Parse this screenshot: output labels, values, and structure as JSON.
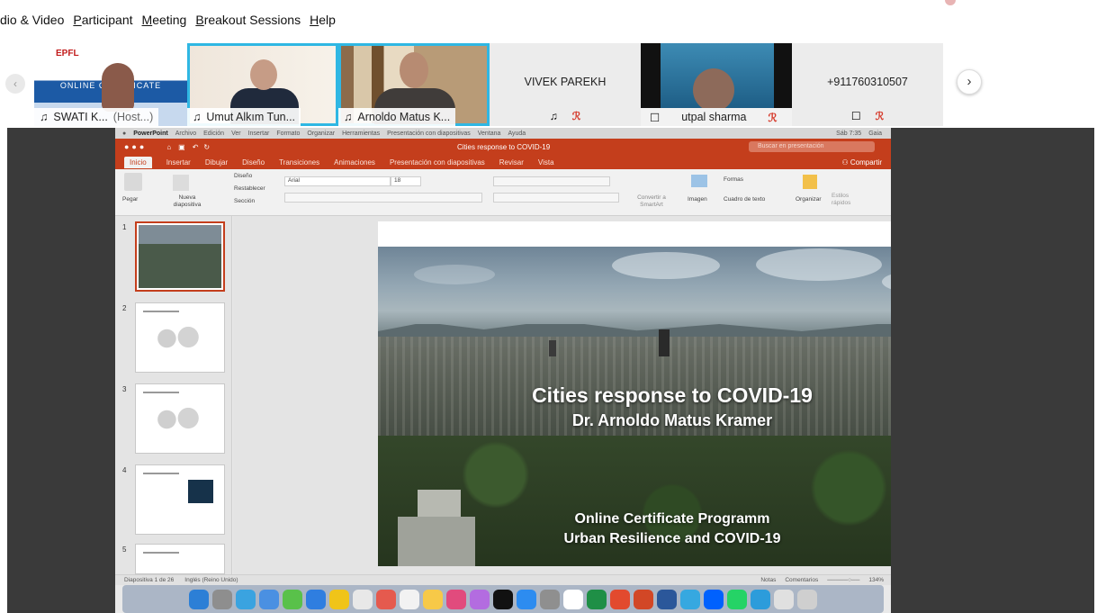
{
  "zoom_menu": {
    "items": [
      "dio & Video",
      "Participant",
      "Meeting",
      "Breakout Sessions",
      "Help"
    ],
    "mnemonics": [
      "",
      "P",
      "M",
      "B",
      "H"
    ]
  },
  "gallery": {
    "nav_left": "‹",
    "nav_right": "›",
    "participants": [
      {
        "name": "SWATI K...",
        "suffix": "(Host...)",
        "tile_logo": "EPFL",
        "tile_banner": "ONLINE CERTIFICATE"
      },
      {
        "name": "Umut Alkım Tun..."
      },
      {
        "name": "Arnoldo Matus K..."
      },
      {
        "name": "VIVEK PAREKH"
      },
      {
        "name": "utpal sharma"
      },
      {
        "name": "+911760310507"
      }
    ],
    "icons": {
      "mic": "♫",
      "mic_muted": "ℛ",
      "phone": "☐"
    }
  },
  "mac": {
    "menubar": [
      "PowerPoint",
      "Archivo",
      "Edición",
      "Ver",
      "Insertar",
      "Formato",
      "Organizar",
      "Herramientas",
      "Presentación con diapositivas",
      "Ventana",
      "Ayuda"
    ],
    "menubar_right": [
      "Sáb 7:35",
      "Gaia"
    ],
    "doc_title": "Cities response to COVID-19",
    "search_placeholder": "Buscar en presentación",
    "ribbon_tabs": [
      "Inicio",
      "Insertar",
      "Dibujar",
      "Diseño",
      "Transiciones",
      "Animaciones",
      "Presentación con diapositivas",
      "Revisar",
      "Vista"
    ],
    "share_label": "Compartir",
    "ribbon": {
      "paste": "Pegar",
      "new_slide": "Nueva diapositiva",
      "layout": "Diseño",
      "reset": "Restablecer",
      "section": "Sección",
      "font": "Arial",
      "size": "18",
      "convert": "Convertir a SmartArt",
      "image": "Imagen",
      "shapes": "Formas",
      "textbox": "Cuadro de texto",
      "arrange": "Organizar",
      "styles": "Estilos rápidos"
    },
    "thumbnails": [
      "1",
      "2",
      "3",
      "4",
      "5"
    ],
    "slide": {
      "title": "Cities response to COVID-19",
      "author": "Dr. Arnoldo Matus Kramer",
      "program1": "Online Certificate Programm",
      "program2": "Urban Resilience and COVID-19"
    },
    "status": {
      "slide_count": "Diapositiva 1 de 26",
      "language": "Inglés (Reino Unido)",
      "notes": "Notas",
      "comments": "Comentarios",
      "zoom": "134%"
    },
    "dock_colors": [
      "#2c7fd6",
      "#8e8e8e",
      "#3aa3e0",
      "#4a90e2",
      "#59c14a",
      "#2f7ee0",
      "#f0c419",
      "#e8e8e8",
      "#e55a4e",
      "#f2f2f2",
      "#f7c948",
      "#e14b7d",
      "#b36ce0",
      "#111111",
      "#2d8cf0",
      "#8f8f8f",
      "#ffffff",
      "#1f8f46",
      "#e24a2e",
      "#d24726",
      "#2b579a",
      "#36a8e0",
      "#0061fe",
      "#25d366",
      "#2c9cdb",
      "#e0e0e0",
      "#cfcfcf"
    ]
  }
}
